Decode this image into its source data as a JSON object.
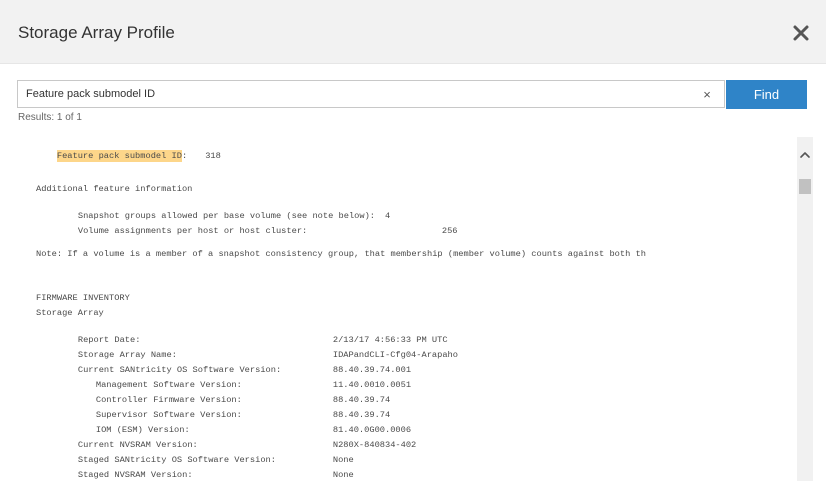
{
  "dialog": {
    "title": "Storage Array Profile",
    "close_icon": "close-icon"
  },
  "search": {
    "value": "Feature pack submodel ID",
    "clear_label": "×",
    "find_label": "Find",
    "results_text": "Results: 1 of 1"
  },
  "profile": {
    "feature_pack": {
      "label": "Feature pack submodel ID",
      "separator": ":",
      "value": "318"
    },
    "additional_header": "Additional feature information",
    "snapshot_groups": {
      "label": "Snapshot groups allowed per base volume (see note below):",
      "value": "4"
    },
    "volume_assignments": {
      "label": "Volume assignments per host or host cluster:",
      "value": "256"
    },
    "note": "Note: If a volume is a member of a snapshot consistency group, that membership (member volume) counts against both th",
    "firmware_header": "FIRMWARE INVENTORY",
    "storage_array_header": "Storage Array",
    "rows": [
      {
        "label": "Report Date:",
        "value": "2/13/17 4:56:33 PM UTC"
      },
      {
        "label": "Storage Array Name:",
        "value": "IDAPandCLI-Cfg04-Arapaho"
      },
      {
        "label": "Current SANtricity OS Software Version:",
        "value": "88.40.39.74.001"
      },
      {
        "label": "Management Software Version:",
        "value": "11.40.0010.0051"
      },
      {
        "label": "Controller Firmware Version:",
        "value": "88.40.39.74"
      },
      {
        "label": "Supervisor Software Version:",
        "value": "88.40.39.74"
      },
      {
        "label": "IOM (ESM) Version:",
        "value": "81.40.0G00.0006"
      },
      {
        "label": "Current NVSRAM Version:",
        "value": "N280X-840834-402"
      },
      {
        "label": "Staged SANtricity OS Software Version:",
        "value": "None"
      },
      {
        "label": "Staged NVSRAM Version:",
        "value": "None"
      }
    ]
  },
  "scrollbar": {
    "up_icon": "chevron-up-icon"
  }
}
